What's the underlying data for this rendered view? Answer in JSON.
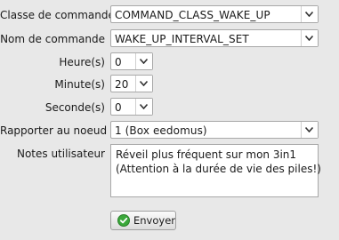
{
  "form": {
    "command_class": {
      "label": "Classe de commande",
      "value": "COMMAND_CLASS_WAKE_UP"
    },
    "command_name": {
      "label": "Nom de commande",
      "value": "WAKE_UP_INTERVAL_SET"
    },
    "hours": {
      "label": "Heure(s)",
      "value": "0"
    },
    "minutes": {
      "label": "Minute(s)",
      "value": "20"
    },
    "seconds": {
      "label": "Seconde(s)",
      "value": "0"
    },
    "report_node": {
      "label": "Rapporter au noeud",
      "value": "1 (Box eedomus)"
    },
    "notes": {
      "label": "Notes utilisateur",
      "value": "Réveil plus fréquent sur mon 3in1\n(Attention à la durée de vie des piles!)"
    }
  },
  "submit": {
    "label": "Envoyer",
    "icon": "checkmark-icon",
    "icon_color": "#3aa83a"
  },
  "dropdown_icon": "chevron-down-icon"
}
